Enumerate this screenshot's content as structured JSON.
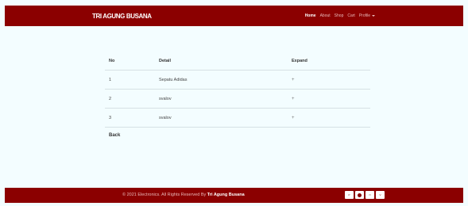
{
  "navbar": {
    "brand": "TRI AGUNG BUSANA",
    "links": [
      "Home",
      "About",
      "Shop",
      "Cart",
      "Profile"
    ]
  },
  "table": {
    "headers": [
      "No",
      "Detail",
      "Expand"
    ],
    "rows": [
      {
        "no": "1",
        "detail": "Sepatu Adidas",
        "expand": "+"
      },
      {
        "no": "2",
        "detail": "svalov",
        "expand": "+"
      },
      {
        "no": "3",
        "detail": "svalov",
        "expand": "+"
      }
    ]
  },
  "back_label": "Back",
  "footer": {
    "copyright": "© 2021 Electronics. All Rights Reserved By ",
    "company": "Tri Agung Busana",
    "payment_icons": [
      "paypal-icon",
      "mastercard-icon",
      "bank-transfer-icon",
      "visa-icon"
    ]
  },
  "colors": {
    "brand": "#8b0000",
    "background": "#f3fdff"
  }
}
